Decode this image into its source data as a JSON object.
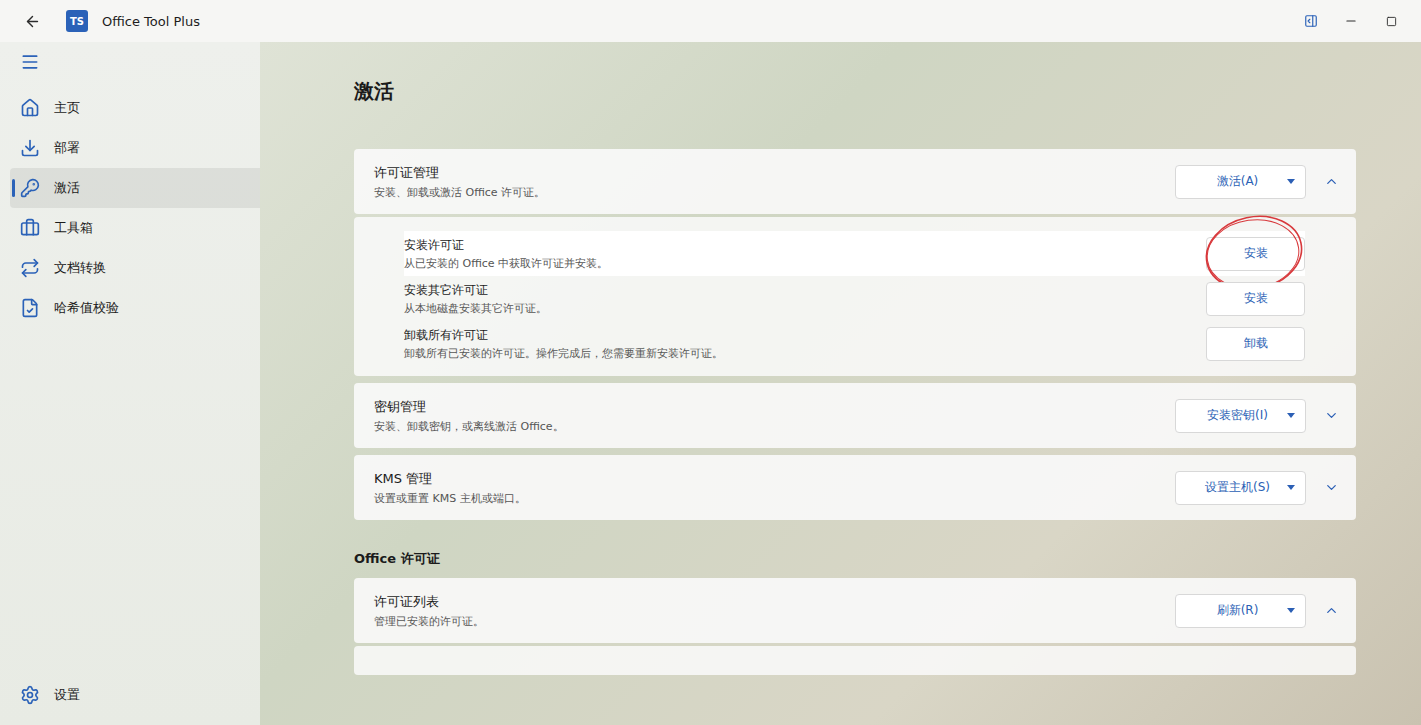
{
  "window": {
    "title": "Office Tool Plus",
    "logo": "TS"
  },
  "sidebar": {
    "items": [
      {
        "label": "主页",
        "selected": false
      },
      {
        "label": "部署",
        "selected": false
      },
      {
        "label": "激活",
        "selected": true
      },
      {
        "label": "工具箱",
        "selected": false
      },
      {
        "label": "文档转换",
        "selected": false
      },
      {
        "label": "哈希值校验",
        "selected": false
      }
    ],
    "footer": {
      "label": "设置",
      "selected": false
    }
  },
  "page": {
    "title": "激活"
  },
  "cards": [
    {
      "title": "许可证管理",
      "description": "安装、卸载或激活 Office 许可证。",
      "action": "激活(A)",
      "expanded": true,
      "rows": [
        {
          "title": "安装许可证",
          "description": "从已安装的 Office 中获取许可证并安装。",
          "button": "安装",
          "highlighted": true,
          "annotated": true
        },
        {
          "title": "安装其它许可证",
          "description": "从本地磁盘安装其它许可证。",
          "button": "安装",
          "highlighted": false,
          "annotated": false
        },
        {
          "title": "卸载所有许可证",
          "description": "卸载所有已安装的许可证。操作完成后，您需要重新安装许可证。",
          "button": "卸载",
          "highlighted": false,
          "annotated": false
        }
      ]
    },
    {
      "title": "密钥管理",
      "description": "安装、卸载密钥，或离线激活 Office。",
      "action": "安装密钥(I)",
      "expanded": false,
      "rows": []
    },
    {
      "title": "KMS 管理",
      "description": "设置或重置 KMS 主机或端口。",
      "action": "设置主机(S)",
      "expanded": false,
      "rows": []
    }
  ],
  "section": {
    "title": "Office 许可证"
  },
  "license_list": {
    "title": "许可证列表",
    "description": "管理已安装的许可证。",
    "action": "刷新(R)",
    "expanded": true,
    "rows": []
  }
}
